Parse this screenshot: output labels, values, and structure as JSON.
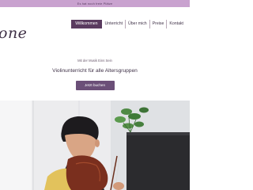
{
  "announcement": "Es hat noch freie Plätze",
  "logo_text": "one",
  "nav": [
    {
      "label": "Willkommen",
      "active": true
    },
    {
      "label": "Unterricht",
      "active": false
    },
    {
      "label": "Über mich",
      "active": false
    },
    {
      "label": "Preise",
      "active": false
    },
    {
      "label": "Kontakt",
      "active": false
    }
  ],
  "hero": {
    "kicker": "Mit der Musik Eins Sein",
    "title": "Violinunterricht für alle Altersgruppen",
    "cta_label": "Jetzt buchen"
  },
  "colors": {
    "topbar": "#c9a2cf",
    "nav_active": "#5a3b5f",
    "button": "#6b4f78",
    "text": "#3f3147"
  }
}
